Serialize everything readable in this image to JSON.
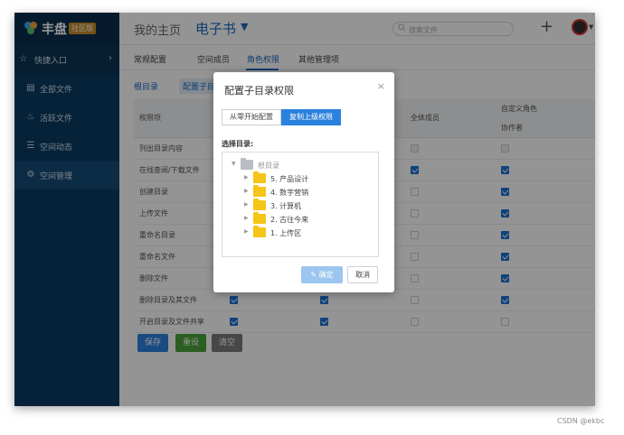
{
  "app": {
    "name": "丰盘",
    "badge": "社区版"
  },
  "sidebar": {
    "quick": {
      "label": "快捷入口"
    },
    "items": [
      {
        "label": "全部文件",
        "icon": "document-icon"
      },
      {
        "label": "活跃文件",
        "icon": "fire-icon"
      },
      {
        "label": "空间动态",
        "icon": "list-icon"
      },
      {
        "label": "空间管理",
        "icon": "gear-icon"
      }
    ]
  },
  "header": {
    "crumb1": "我的主页",
    "crumb2": "电子书",
    "search_placeholder": "搜索文件"
  },
  "tabs": [
    "常规配置",
    "空间成员",
    "角色权限",
    "其他管理项"
  ],
  "subnav": {
    "dir": "根目录",
    "config": "配置子目录"
  },
  "table": {
    "col_perm": "权限项",
    "col_all": "全体成员",
    "col_custom": "自定义角色",
    "col_collab": "协作者",
    "rows": [
      {
        "label": "列出目录内容",
        "a": "dis",
        "b": "on",
        "all": "dis",
        "custom": "dis"
      },
      {
        "label": "在线查阅/下载文件",
        "a": "on",
        "b": "on",
        "all": "on",
        "custom": "on"
      },
      {
        "label": "创建目录",
        "a": "on",
        "b": "on",
        "all": "off",
        "custom": "on"
      },
      {
        "label": "上传文件",
        "a": "on",
        "b": "on",
        "all": "off",
        "custom": "on"
      },
      {
        "label": "重命名目录",
        "a": "on",
        "b": "on",
        "all": "off",
        "custom": "on"
      },
      {
        "label": "重命名文件",
        "a": "on",
        "b": "on",
        "all": "off",
        "custom": "on"
      },
      {
        "label": "删除文件",
        "a": "on",
        "b": "on",
        "all": "off",
        "custom": "on"
      },
      {
        "label": "删除目录及其文件",
        "a": "on",
        "b": "on",
        "all": "off",
        "custom": "on"
      },
      {
        "label": "开启目录及文件共享",
        "a": "on",
        "b": "on",
        "all": "off",
        "custom": "off"
      }
    ]
  },
  "buttons": {
    "save": "保存",
    "reset": "重设",
    "clear": "清空"
  },
  "dialog": {
    "title": "配置子目录权限",
    "seg_scratch": "从零开始配置",
    "seg_copy": "复制上级权限",
    "select_label": "选择目录:",
    "root": "根目录",
    "folders": [
      "5. 产品设计",
      "4. 数字营销",
      "3. 计算机",
      "2. 古往今来",
      "1. 上传区"
    ],
    "ok": "确定",
    "cancel": "取消"
  },
  "watermark": "CSDN @ekbc",
  "colors": {
    "sidebar": "#0c3b62",
    "accent": "#1b6ac0",
    "save": "#2b82de",
    "reset": "#4aa33c",
    "clear": "#7a7a7a",
    "folder": "#f5c518"
  }
}
